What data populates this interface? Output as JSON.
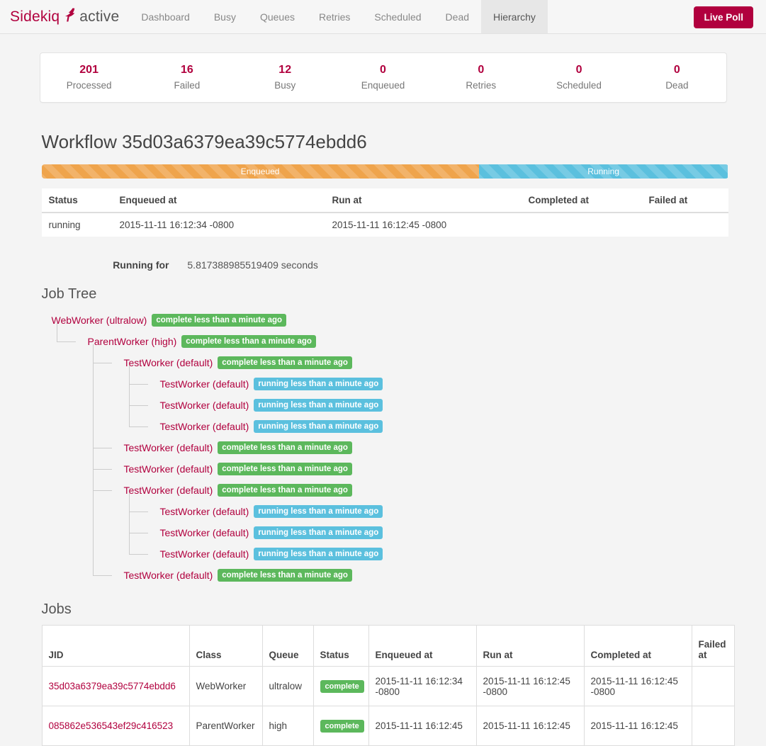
{
  "navbar": {
    "brand_sidekiq": "Sidekiq",
    "brand_bird_icon": "bird-icon",
    "brand_active": "active",
    "items": [
      {
        "label": "Dashboard",
        "active": false
      },
      {
        "label": "Busy",
        "active": false
      },
      {
        "label": "Queues",
        "active": false
      },
      {
        "label": "Retries",
        "active": false
      },
      {
        "label": "Scheduled",
        "active": false
      },
      {
        "label": "Dead",
        "active": false
      },
      {
        "label": "Hierarchy",
        "active": true
      }
    ],
    "live_poll_label": "Live Poll",
    "brand_color": "#b1003e"
  },
  "stats": [
    {
      "value": "201",
      "label": "Processed"
    },
    {
      "value": "16",
      "label": "Failed"
    },
    {
      "value": "12",
      "label": "Busy"
    },
    {
      "value": "0",
      "label": "Enqueued"
    },
    {
      "value": "0",
      "label": "Retries"
    },
    {
      "value": "0",
      "label": "Scheduled"
    },
    {
      "value": "0",
      "label": "Dead"
    }
  ],
  "workflow": {
    "title": "Workflow 35d03a6379ea39c5774ebdd6",
    "progress": {
      "segments": [
        {
          "label": "Enqueued",
          "percent": 63.7,
          "color": "#efa44c"
        },
        {
          "label": "Running",
          "percent": 36.3,
          "color": "#5bc0de"
        }
      ]
    },
    "status_table": {
      "headers": [
        "Status",
        "Enqueued at",
        "Run at",
        "Completed at",
        "Failed at"
      ],
      "rows": [
        [
          "running",
          "2015-11-11 16:12:34 -0800",
          "2015-11-11 16:12:45 -0800",
          "",
          ""
        ]
      ]
    },
    "running_for_label": "Running for",
    "running_for_value": "5.817388985519409 seconds"
  },
  "job_tree": {
    "heading": "Job Tree",
    "nodes": [
      {
        "label": "WebWorker (ultralow)",
        "badge": "complete less than a minute ago",
        "state": "complete",
        "depth": 0
      },
      {
        "label": "ParentWorker (high)",
        "badge": "complete less than a minute ago",
        "state": "complete",
        "depth": 1
      },
      {
        "label": "TestWorker (default)",
        "badge": "complete less than a minute ago",
        "state": "complete",
        "depth": 2
      },
      {
        "label": "TestWorker (default)",
        "badge": "running less than a minute ago",
        "state": "running",
        "depth": 3
      },
      {
        "label": "TestWorker (default)",
        "badge": "running less than a minute ago",
        "state": "running",
        "depth": 3
      },
      {
        "label": "TestWorker (default)",
        "badge": "running less than a minute ago",
        "state": "running",
        "depth": 3
      },
      {
        "label": "TestWorker (default)",
        "badge": "complete less than a minute ago",
        "state": "complete",
        "depth": 2
      },
      {
        "label": "TestWorker (default)",
        "badge": "complete less than a minute ago",
        "state": "complete",
        "depth": 2
      },
      {
        "label": "TestWorker (default)",
        "badge": "complete less than a minute ago",
        "state": "complete",
        "depth": 2
      },
      {
        "label": "TestWorker (default)",
        "badge": "running less than a minute ago",
        "state": "running",
        "depth": 3
      },
      {
        "label": "TestWorker (default)",
        "badge": "running less than a minute ago",
        "state": "running",
        "depth": 3
      },
      {
        "label": "TestWorker (default)",
        "badge": "running less than a minute ago",
        "state": "running",
        "depth": 3
      },
      {
        "label": "TestWorker (default)",
        "badge": "complete less than a minute ago",
        "state": "complete",
        "depth": 2
      }
    ]
  },
  "jobs": {
    "heading": "Jobs",
    "headers": [
      "JID",
      "Class",
      "Queue",
      "Status",
      "Enqueued at",
      "Run at",
      "Completed at",
      "Failed at"
    ],
    "rows": [
      {
        "jid": "35d03a6379ea39c5774ebdd6",
        "class": "WebWorker",
        "queue": "ultralow",
        "status": "complete",
        "enqueued_at": "2015-11-11 16:12:34 -0800",
        "run_at": "2015-11-11 16:12:45 -0800",
        "completed_at": "2015-11-11 16:12:45 -0800",
        "failed_at": ""
      },
      {
        "jid": "085862e536543ef29c416523",
        "class": "ParentWorker",
        "queue": "high",
        "status": "complete",
        "enqueued_at": "2015-11-11 16:12:45",
        "run_at": "2015-11-11 16:12:45",
        "completed_at": "2015-11-11 16:12:45",
        "failed_at": ""
      }
    ]
  }
}
